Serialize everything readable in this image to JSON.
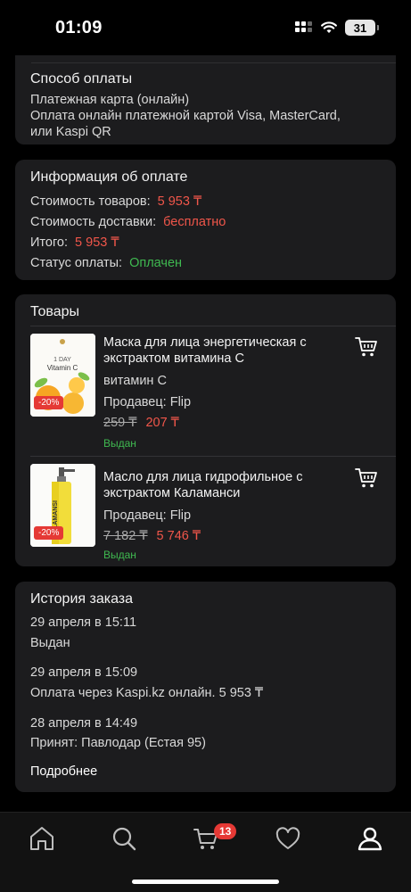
{
  "status_bar": {
    "time": "01:09",
    "battery": "31"
  },
  "payment_method": {
    "title": "Способ оплаты",
    "line1": "Платежная карта (онлайн)",
    "line2": "Оплата онлайн платежной картой Visa, MasterCard,",
    "line3": "или Kaspi QR"
  },
  "payment_info": {
    "title": "Информация об оплате",
    "goods_label": "Стоимость товаров:",
    "goods_value": "5 953 ₸",
    "delivery_label": "Стоимость доставки:",
    "delivery_value": "бесплатно",
    "total_label": "Итого:",
    "total_value": "5 953 ₸",
    "status_label": "Статус оплаты:",
    "status_value": "Оплачен"
  },
  "products": {
    "title": "Товары",
    "items": [
      {
        "name_line1": "Маска для лица энергетическая с",
        "name_line2": "экстрактом витамина С",
        "variant": "витамин С",
        "seller": "Продавец: Flip",
        "old_price": "259 ₸",
        "price": "207 ₸",
        "status": "Выдан",
        "discount": "-20%",
        "img_text1": "1 DAY",
        "img_text2": "Vitamin C"
      },
      {
        "name_line1": "Масло для лица гидрофильное с",
        "name_line2": "экстрактом Каламанси",
        "seller": "Продавец: Flip",
        "old_price": "7 182 ₸",
        "price": "5 746 ₸",
        "status": "Выдан",
        "discount": "-20%",
        "img_text": "ALAMANSI"
      }
    ]
  },
  "history": {
    "title": "История заказа",
    "entries": [
      {
        "date": "29 апреля в 15:11",
        "text": "Выдан"
      },
      {
        "date": "29 апреля в 15:09",
        "text": "Оплата через Kaspi.kz онлайн. 5 953 ₸"
      },
      {
        "date": "28 апреля в 14:49",
        "text": "Принят: Павлодар (Естая 95)"
      }
    ],
    "more": "Подробнее"
  },
  "nav": {
    "cart_badge": "13"
  },
  "colors": {
    "accent_red": "#f0564a",
    "status_green": "#3fb950",
    "card_bg": "#1c1c1e"
  }
}
